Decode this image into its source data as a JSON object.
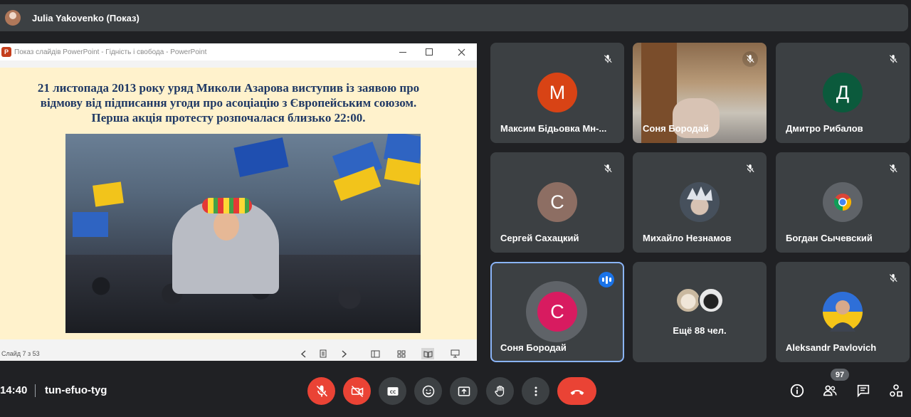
{
  "presenter": {
    "name": "Julia Yakovenko (Показ)"
  },
  "ppt": {
    "window_title": "Показ слайдів PowerPoint - Гідність і свобода - PowerPoint",
    "logo_letter": "P",
    "slide_text": "21 листопада 2013 року уряд Миколи Азарова виступив із заявою про відмову від підписання угоди про асоціацію з Європейським союзом. Перша акція протесту розпочалася близько 22:00.",
    "slide_counter": "Слайд 7 з 53"
  },
  "tiles": [
    {
      "name": "Максим Бідьовка Мн-...",
      "initial": "М",
      "color": "#d84315",
      "muted": true
    },
    {
      "name": "Соня Бородай",
      "initial": "",
      "muted": true,
      "video": true
    },
    {
      "name": "Дмитро Рибалов",
      "initial": "Д",
      "color": "#0b5a3c",
      "muted": true
    },
    {
      "name": "Сергей Сахацкий",
      "initial": "С",
      "color": "#8d6e63",
      "muted": true
    },
    {
      "name": "Михайло Незнамов",
      "initial": "",
      "muted": true,
      "anime": true
    },
    {
      "name": "Богдан Сычевский",
      "initial": "",
      "muted": true,
      "chrome": true
    },
    {
      "name": "Соня Бородай",
      "initial": "С",
      "color": "#d81b60",
      "speaking": true
    },
    {
      "more": "Ещё 88 чел."
    },
    {
      "name": "Aleksandr Pavlovich",
      "initial": "",
      "muted": true,
      "photo": true
    }
  ],
  "bottombar": {
    "time": "14:40",
    "meeting_code": "tun-efuo-tyg",
    "participants_count": "97"
  },
  "colors": {
    "background": "#202124",
    "tile": "#3c4043",
    "danger": "#ea4335",
    "active_border": "#8ab4f8"
  }
}
